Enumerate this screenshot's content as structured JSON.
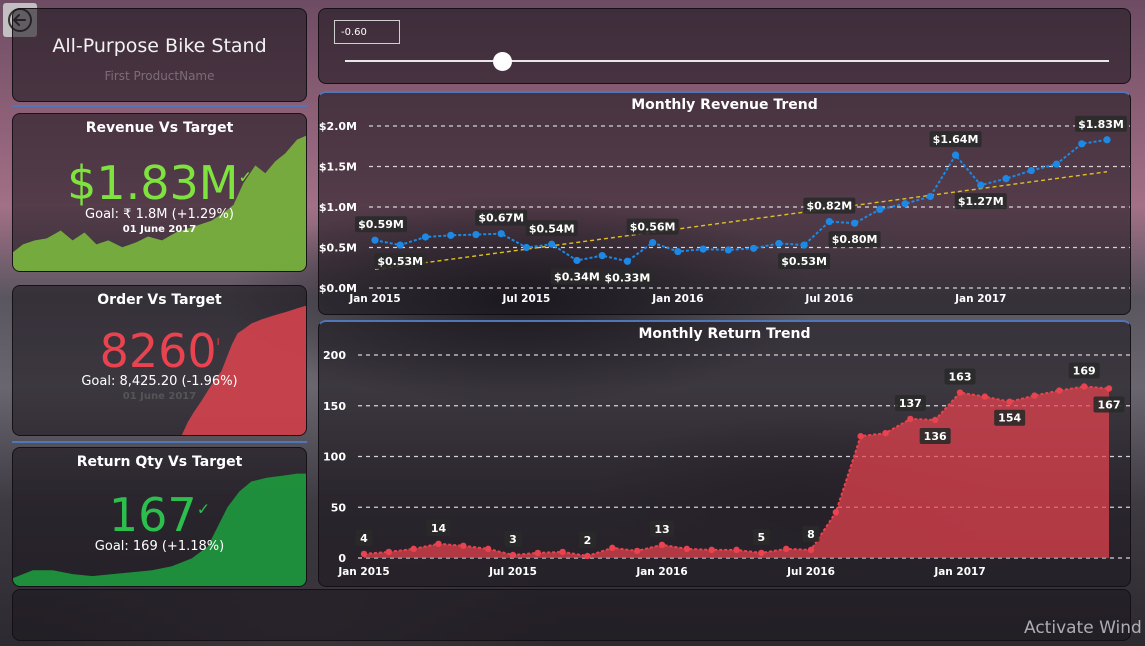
{
  "product": {
    "title": "All-Purpose Bike Stand",
    "subtitle": "First ProductName"
  },
  "kpis": {
    "revenue": {
      "title": "Revenue Vs Target",
      "value": "$1.83M",
      "goal": "Goal: ₹ 1.8M (+1.29%)",
      "date": "01 June 2017",
      "color": "#7ee33f",
      "area_color": "#79b43e"
    },
    "order": {
      "title": "Order Vs Target",
      "value": "8260",
      "goal": "Goal: 8,425.20 (-1.96%)",
      "date": "01 June 2017",
      "color": "#e8434f",
      "area_color": "#d8434f"
    },
    "return": {
      "title": "Return Qty Vs Target",
      "value": "167",
      "goal": "Goal: 169 (+1.18%)",
      "color": "#2cbf4e",
      "area_color": "#1e9a3e"
    }
  },
  "slider": {
    "value": "-0.60",
    "position_fraction": 0.206
  },
  "watermark": "Activate Wind",
  "chart_data": [
    {
      "type": "line",
      "title": "Monthly Revenue Trend",
      "series_color": "#1e88e5",
      "trend_color": "#e0c020",
      "x_tick_labels": [
        "Jan 2015",
        "Jul 2015",
        "Jan 2016",
        "Jul 2016",
        "Jan 2017"
      ],
      "y_tick_labels": [
        "$0.0M",
        "$0.5M",
        "$1.0M",
        "$1.5M",
        "$2.0M"
      ],
      "ylim": [
        0,
        2.0
      ],
      "x": [
        "2015-01",
        "2015-02",
        "2015-03",
        "2015-04",
        "2015-05",
        "2015-06",
        "2015-07",
        "2015-08",
        "2015-09",
        "2015-10",
        "2015-11",
        "2015-12",
        "2016-01",
        "2016-02",
        "2016-03",
        "2016-04",
        "2016-05",
        "2016-06",
        "2016-07",
        "2016-08",
        "2016-09",
        "2016-10",
        "2016-11",
        "2016-12",
        "2017-01",
        "2017-02",
        "2017-03",
        "2017-04",
        "2017-05",
        "2017-06"
      ],
      "values": [
        0.59,
        0.53,
        0.63,
        0.65,
        0.66,
        0.67,
        0.5,
        0.54,
        0.34,
        0.4,
        0.33,
        0.56,
        0.45,
        0.48,
        0.47,
        0.49,
        0.55,
        0.53,
        0.82,
        0.8,
        0.97,
        1.04,
        1.13,
        1.64,
        1.27,
        1.35,
        1.45,
        1.53,
        1.78,
        1.83
      ],
      "point_labels": [
        {
          "index": 0,
          "text": "$0.59M",
          "pos": "above"
        },
        {
          "index": 1,
          "text": "$0.53M",
          "pos": "below"
        },
        {
          "index": 5,
          "text": "$0.67M",
          "pos": "above"
        },
        {
          "index": 7,
          "text": "$0.54M",
          "pos": "above"
        },
        {
          "index": 8,
          "text": "$0.34M",
          "pos": "below"
        },
        {
          "index": 10,
          "text": "$0.33M",
          "pos": "below"
        },
        {
          "index": 11,
          "text": "$0.56M",
          "pos": "above"
        },
        {
          "index": 17,
          "text": "$0.53M",
          "pos": "below"
        },
        {
          "index": 18,
          "text": "$0.82M",
          "pos": "above"
        },
        {
          "index": 19,
          "text": "$0.80M",
          "pos": "below"
        },
        {
          "index": 23,
          "text": "$1.64M",
          "pos": "above"
        },
        {
          "index": 24,
          "text": "$1.27M",
          "pos": "below"
        },
        {
          "index": 29,
          "text": "$1.83M",
          "pos": "above"
        }
      ]
    },
    {
      "type": "area",
      "title": "Monthly Return Trend",
      "series_color": "#e8434f",
      "x_tick_labels": [
        "Jan 2015",
        "Jul 2015",
        "Jan 2016",
        "Jul 2016",
        "Jan 2017"
      ],
      "y_tick_labels": [
        "0",
        "50",
        "100",
        "150",
        "200"
      ],
      "ylim": [
        0,
        200
      ],
      "x": [
        "2015-01",
        "2015-02",
        "2015-03",
        "2015-04",
        "2015-05",
        "2015-06",
        "2015-07",
        "2015-08",
        "2015-09",
        "2015-10",
        "2015-11",
        "2015-12",
        "2016-01",
        "2016-02",
        "2016-03",
        "2016-04",
        "2016-05",
        "2016-06",
        "2016-07",
        "2016-08",
        "2016-09",
        "2016-10",
        "2016-11",
        "2016-12",
        "2017-01",
        "2017-02",
        "2017-03",
        "2017-04",
        "2017-05",
        "2017-06"
      ],
      "values": [
        4,
        6,
        9,
        14,
        12,
        9,
        3,
        5,
        6,
        2,
        10,
        7,
        13,
        9,
        8,
        8,
        5,
        9,
        8,
        45,
        120,
        123,
        137,
        136,
        163,
        159,
        154,
        160,
        165,
        169,
        167
      ],
      "point_labels": [
        {
          "index": 0,
          "text": "4",
          "pos": "above"
        },
        {
          "index": 3,
          "text": "14",
          "pos": "above"
        },
        {
          "index": 6,
          "text": "3",
          "pos": "above"
        },
        {
          "index": 9,
          "text": "2",
          "pos": "above"
        },
        {
          "index": 12,
          "text": "13",
          "pos": "above"
        },
        {
          "index": 16,
          "text": "5",
          "pos": "above"
        },
        {
          "index": 18,
          "text": "8",
          "pos": "above"
        },
        {
          "index": 22,
          "text": "137",
          "pos": "above"
        },
        {
          "index": 23,
          "text": "136",
          "pos": "below"
        },
        {
          "index": 24,
          "text": "163",
          "pos": "above"
        },
        {
          "index": 26,
          "text": "154",
          "pos": "below"
        },
        {
          "index": 29,
          "text": "169",
          "pos": "above"
        },
        {
          "index": 30,
          "text": "167",
          "pos": "below"
        }
      ]
    }
  ]
}
